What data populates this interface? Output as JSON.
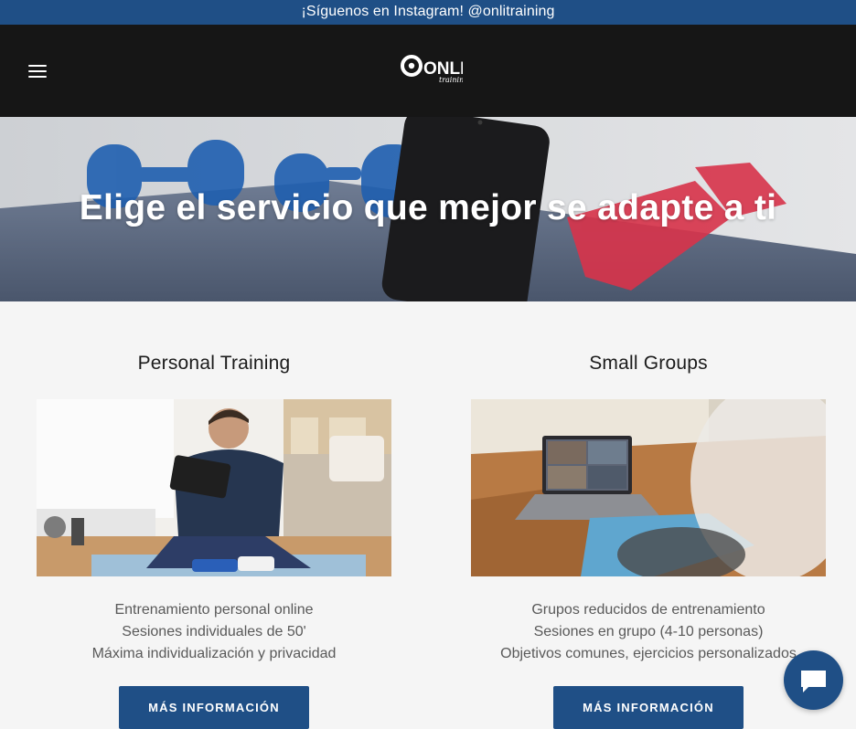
{
  "announcement": {
    "text": "¡Síguenos en Instagram! @onlitraining"
  },
  "header": {
    "menu_icon": "hamburger-menu-icon",
    "logo": {
      "main": "ONLI",
      "sub": "training"
    }
  },
  "hero": {
    "title": "Elige el servicio que mejor se adapte a ti"
  },
  "services": [
    {
      "title": "Personal Training",
      "lines": [
        "Entrenamiento personal online",
        "Sesiones individuales de 50'",
        "Máxima individualización y privacidad"
      ],
      "button": "MÁS INFORMACIÓN"
    },
    {
      "title": "Small Groups",
      "lines": [
        "Grupos reducidos de entrenamiento",
        "Sesiones en grupo (4-10 personas)",
        "Objetivos comunes, ejercicios personalizados"
      ],
      "button": "MÁS INFORMACIÓN"
    }
  ],
  "chat": {
    "icon": "chat-bubble-icon"
  },
  "colors": {
    "brand": "#1f4f86",
    "header_bg": "#161616",
    "page_bg": "#f5f5f5"
  }
}
